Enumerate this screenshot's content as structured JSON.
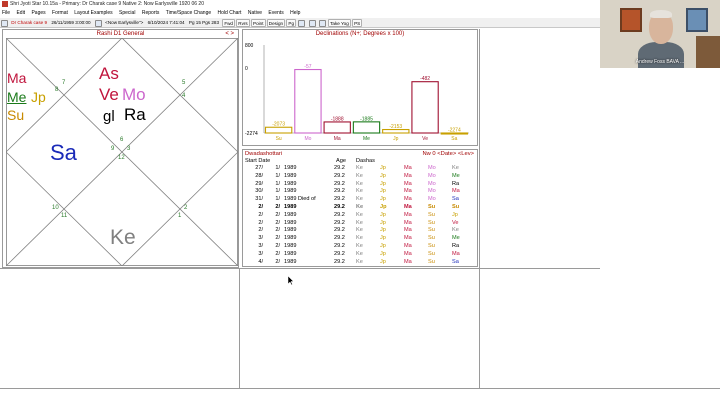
{
  "titlebar": {
    "title": "Shri Jyoti Star 10.15a  -  Primary: Dr Charak case 9    Native 2: Now Earlysville   1920  06  20"
  },
  "menu": [
    "File",
    "Edit",
    "Pages",
    "Format",
    "Layout Examples",
    "Special",
    "Reports",
    "Time/Space Change",
    "Hold Chart",
    "Native",
    "Events",
    "Help"
  ],
  "toolbar": {
    "chart_name": "Dr Charak case 9",
    "chart_datetime": "26/11/1959  3:00:00",
    "now_location": "<Now Earlysville\">",
    "now_datetime": "6/10/2024   7:41:04",
    "pg_label": "Pg 15 Pgs 283",
    "buttons": [
      "Fwd",
      "Rvrs",
      "Point",
      "Design",
      "Pg",
      "Take Yog",
      "PS"
    ]
  },
  "rashi": {
    "title": "Rashi D1 General",
    "nav": "< >",
    "planets": [
      {
        "label": "Ma",
        "color": "#c0143c"
      },
      {
        "label": "Me",
        "color": "#1a7a1a",
        "underline": true
      },
      {
        "label": "Jp",
        "color": "#c8a000"
      },
      {
        "label": "Su",
        "color": "#c88a00"
      },
      {
        "label": "As",
        "color": "#c0143c"
      },
      {
        "label": "Ve",
        "color": "#c0143c"
      },
      {
        "label": "Mo",
        "color": "#cc66cc"
      },
      {
        "label": "gl",
        "color": "#000000"
      },
      {
        "label": "Ra",
        "color": "#000000"
      },
      {
        "label": "Sa",
        "color": "#1a2ab8"
      },
      {
        "label": "Ke",
        "color": "#808080"
      }
    ],
    "sign_numbers": [
      "8",
      "7",
      "5",
      "4",
      "6",
      "9",
      "3",
      "12",
      "10",
      "2",
      "11",
      "1"
    ]
  },
  "declinations": {
    "title": "Declinations (N+; Degrees x 100)",
    "y_ticks": [
      "800",
      "0",
      "-2274"
    ],
    "bars": [
      {
        "planet": "Su",
        "value": "-2073",
        "color": "#c8a000"
      },
      {
        "planet": "Mo",
        "value": "-57",
        "color": "#cc66cc"
      },
      {
        "planet": "Ma",
        "value": "-1888",
        "color": "#a01030"
      },
      {
        "planet": "Me",
        "value": "-1885",
        "color": "#1a7a1a"
      },
      {
        "planet": "Jp",
        "value": "-2153",
        "color": "#c8a000"
      },
      {
        "planet": "Ve",
        "value": "-482",
        "color": "#a01030"
      },
      {
        "planet": "Sa",
        "value": "-2274",
        "color": "#c8a000"
      }
    ]
  },
  "dasha": {
    "title": "Dwadashottari",
    "nav": "Nw 0 <Date> <Lev>",
    "columns": {
      "start_date": "Start Date",
      "age": "Age",
      "dashas": "Dashas"
    },
    "rows": [
      {
        "day": "27/",
        "mon": "1/",
        "yr": "1989",
        "age": "29.2",
        "d": [
          "Ke",
          "Jp",
          "Ma",
          "Mo",
          "Ke"
        ],
        "bold": false
      },
      {
        "day": "28/",
        "mon": "1/",
        "yr": "1989",
        "age": "29.2",
        "d": [
          "Ke",
          "Jp",
          "Ma",
          "Mo",
          "Me"
        ],
        "bold": false
      },
      {
        "day": "29/",
        "mon": "1/",
        "yr": "1989",
        "age": "29.2",
        "d": [
          "Ke",
          "Jp",
          "Ma",
          "Mo",
          "Ra"
        ],
        "bold": false
      },
      {
        "day": "30/",
        "mon": "1/",
        "yr": "1989",
        "age": "29.2",
        "d": [
          "Ke",
          "Jp",
          "Ma",
          "Mo",
          "Ma"
        ],
        "bold": false
      },
      {
        "day": "31/",
        "mon": "1/",
        "yr": "1989 Died of",
        "age": "29.2",
        "d": [
          "Ke",
          "Jp",
          "Ma",
          "Mo",
          "Sa"
        ],
        "bold": false
      },
      {
        "day": "2/",
        "mon": "2/",
        "yr": "1989",
        "age": "29.2",
        "d": [
          "Ke",
          "Jp",
          "Ma",
          "Su",
          "Su"
        ],
        "bold": true
      },
      {
        "day": "2/",
        "mon": "2/",
        "yr": "1989",
        "age": "29.2",
        "d": [
          "Ke",
          "Jp",
          "Ma",
          "Su",
          "Jp"
        ],
        "bold": false
      },
      {
        "day": "2/",
        "mon": "2/",
        "yr": "1989",
        "age": "29.2",
        "d": [
          "Ke",
          "Jp",
          "Ma",
          "Su",
          "Ve"
        ],
        "bold": false
      },
      {
        "day": "2/",
        "mon": "2/",
        "yr": "1989",
        "age": "29.2",
        "d": [
          "Ke",
          "Jp",
          "Ma",
          "Su",
          "Ke"
        ],
        "bold": false
      },
      {
        "day": "3/",
        "mon": "2/",
        "yr": "1989",
        "age": "29.2",
        "d": [
          "Ke",
          "Jp",
          "Ma",
          "Su",
          "Me"
        ],
        "bold": false
      },
      {
        "day": "3/",
        "mon": "2/",
        "yr": "1989",
        "age": "29.2",
        "d": [
          "Ke",
          "Jp",
          "Ma",
          "Su",
          "Ra"
        ],
        "bold": false
      },
      {
        "day": "3/",
        "mon": "2/",
        "yr": "1989",
        "age": "29.2",
        "d": [
          "Ke",
          "Jp",
          "Ma",
          "Su",
          "Ma"
        ],
        "bold": false
      },
      {
        "day": "4/",
        "mon": "2/",
        "yr": "1989",
        "age": "29.2",
        "d": [
          "Ke",
          "Jp",
          "Ma",
          "Su",
          "Sa"
        ],
        "bold": false
      }
    ],
    "planet_colors": {
      "Ke": "#808080",
      "Jp": "#c8a000",
      "Ma": "#c0143c",
      "Mo": "#cc66cc",
      "Su": "#c88a00",
      "Me": "#1a7a1a",
      "Ra": "#000000",
      "Sa": "#1a2ab8",
      "Ve": "#c0143c"
    }
  },
  "webcam": {
    "name": "Andrew Foss BAVA ..."
  }
}
